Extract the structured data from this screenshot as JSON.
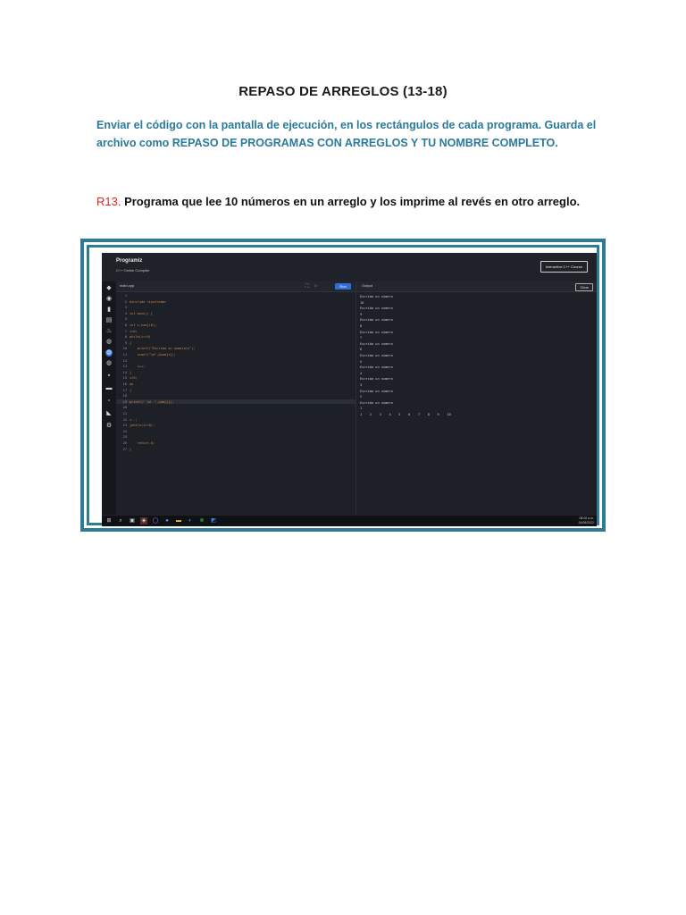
{
  "document": {
    "title": "REPASO DE ARREGLOS (13-18)",
    "instructions": "Enviar el código con la pantalla de ejecución, en los rectángulos de cada programa. Guarda el archivo como REPASO DE PROGRAMAS CON ARREGLOS Y TU NOMBRE COMPLETO.",
    "exercise_tag": "R13.",
    "exercise_text": " Programa que lee 10 números en un arreglo y los imprime al revés en otro arreglo."
  },
  "screenshot": {
    "app": {
      "logo": "Programiz",
      "subtitle": "C++ Online Compiler",
      "course_button": "Interactive C++ Course"
    },
    "editor": {
      "tab": "main.cpp",
      "run_label": "Run",
      "lines": [
        {
          "n": "1",
          "code": ""
        },
        {
          "n": "2",
          "code": "#include <iostream>"
        },
        {
          "n": "3",
          "code": ""
        },
        {
          "n": "4",
          "code": "int main() {"
        },
        {
          "n": "5",
          "code": ""
        },
        {
          "n": "6",
          "code": "int i,num[10];"
        },
        {
          "n": "7",
          "code": "i=0;"
        },
        {
          "n": "8",
          "code": "while(i<=9)"
        },
        {
          "n": "9",
          "code": "{"
        },
        {
          "n": "10",
          "code": "    printf(\"Escriba un numero\\n\");"
        },
        {
          "n": "11",
          "code": "    scanf(\"%d\",&num[i]);"
        },
        {
          "n": "12",
          "code": ""
        },
        {
          "n": "13",
          "code": "    i++;"
        },
        {
          "n": "14",
          "code": "}"
        },
        {
          "n": "15",
          "code": "i=9;"
        },
        {
          "n": "16",
          "code": "do"
        },
        {
          "n": "17",
          "code": "{"
        },
        {
          "n": "18",
          "code": ""
        },
        {
          "n": "19",
          "code": "printf(\" %d  \",num[i]);"
        },
        {
          "n": "20",
          "code": ""
        },
        {
          "n": "21",
          "code": ""
        },
        {
          "n": "22",
          "code": "i--;"
        },
        {
          "n": "23",
          "code": "}while(i>=0);"
        },
        {
          "n": "24",
          "code": ""
        },
        {
          "n": "25",
          "code": ""
        },
        {
          "n": "26",
          "code": "    return 0;"
        },
        {
          "n": "27",
          "code": "}"
        }
      ]
    },
    "output": {
      "title": "Output",
      "clear_label": "Clear",
      "lines": [
        "Escriba un numero",
        "10",
        "Escriba un numero",
        "9",
        "Escriba un numero",
        "8",
        "Escriba un numero",
        "7",
        "Escriba un numero",
        "6",
        "Escriba un numero",
        "5",
        "Escriba un numero",
        "4",
        "Escriba un numero",
        "3",
        "Escriba un numero",
        "2",
        "Escriba un numero",
        "1",
        "1    2    3    4    5    6    7    8    9    10"
      ]
    },
    "taskbar": {
      "time": "08:00 a.m.",
      "date": "24/05/2022"
    }
  }
}
